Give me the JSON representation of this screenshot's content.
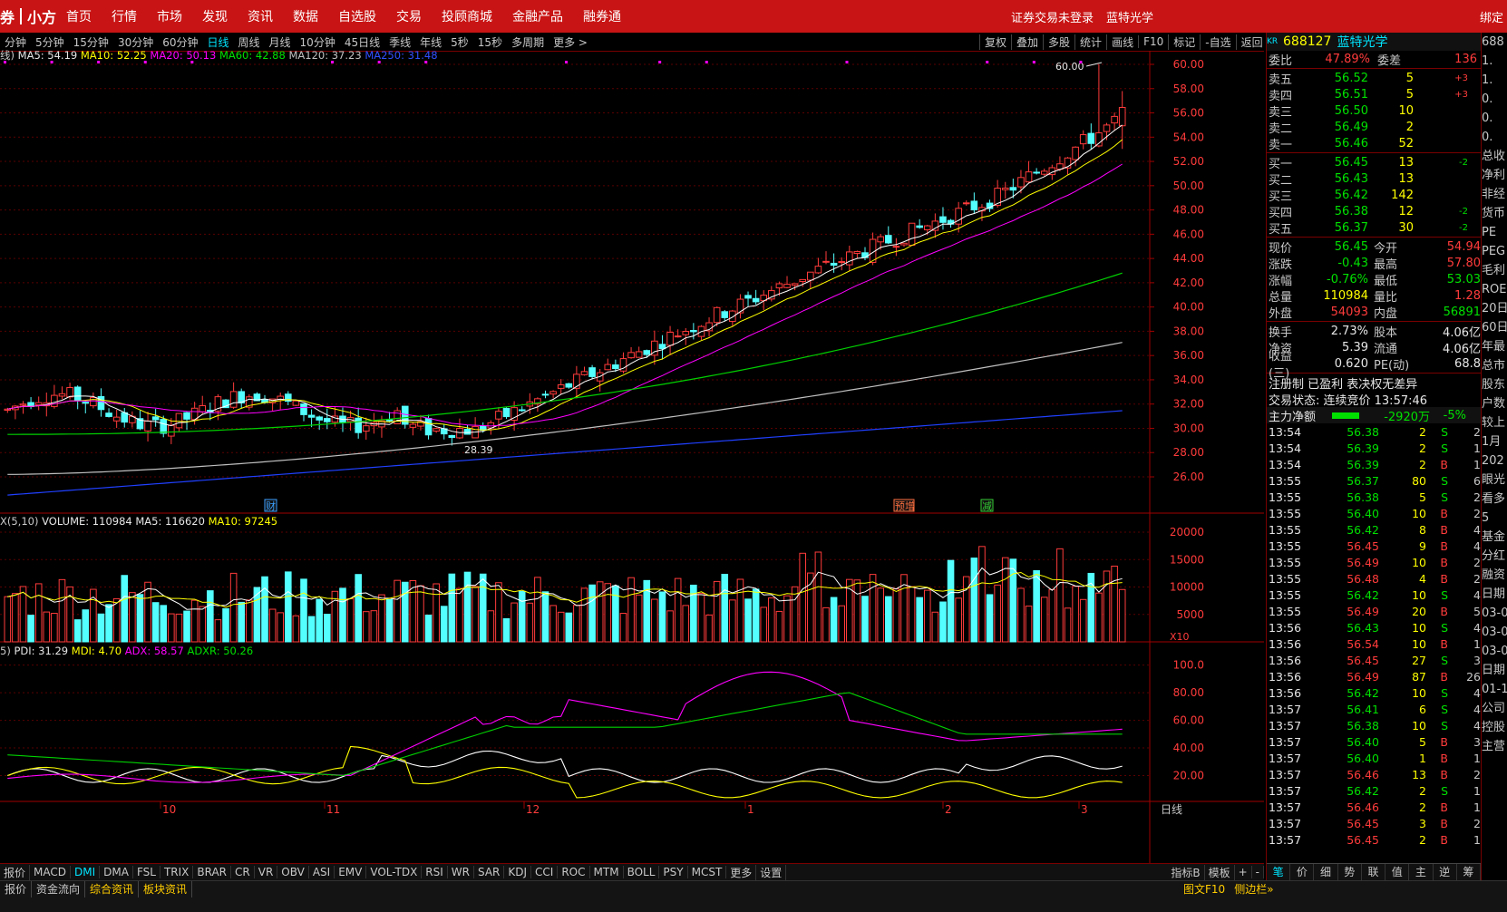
{
  "topbar": {
    "brand_left": "券",
    "brand_right": "小方",
    "nav": [
      "首页",
      "行情",
      "市场",
      "发现",
      "资讯",
      "数据",
      "自选股",
      "交易",
      "投顾商城",
      "金融产品",
      "融券通"
    ],
    "login_status": "证券交易未登录",
    "stock_name": "蓝特光学",
    "bind": "绑定"
  },
  "periods": [
    "分钟",
    "5分钟",
    "15分钟",
    "30分钟",
    "60分钟",
    "日线",
    "周线",
    "月线",
    "10分钟",
    "45日线",
    "季线",
    "年线",
    "5秒",
    "15秒",
    "多周期",
    "更多 >"
  ],
  "active_period": "日线",
  "tools": [
    "复权",
    "叠加",
    "多股",
    "统计",
    "画线",
    "F10",
    "标记",
    "-自选",
    "返回"
  ],
  "ma_legend": {
    "prefix": "线)",
    "ma5": "MA5: 54.19",
    "ma10": "MA10: 52.25",
    "ma20": "MA20: 50.13",
    "ma60": "MA60: 42.88",
    "ma120": "MA120: 37.23",
    "ma250": "MA250: 31.48"
  },
  "vol_legend": {
    "prefix": "X(5,10)",
    "volume": "VOLUME: 110984",
    "ma5": "MA5: 116620",
    "ma10": "MA10: 97245"
  },
  "dmi_legend": {
    "prefix": "5)",
    "pdi": "PDI: 31.29",
    "mdi": "MDI: 4.70",
    "adx": "ADX: 58.57",
    "adxr": "ADXR: 50.26"
  },
  "price_axis": [
    "60.00",
    "58.00",
    "56.00",
    "54.00",
    "52.00",
    "50.00",
    "48.00",
    "46.00",
    "44.00",
    "42.00",
    "40.00",
    "38.00",
    "36.00",
    "34.00",
    "32.00",
    "30.00",
    "28.00",
    "26.00"
  ],
  "vol_axis": [
    "20000",
    "15000",
    "10000",
    "5000"
  ],
  "vol_unit": "X10",
  "dmi_axis": [
    "100.0",
    "80.00",
    "60.00",
    "40.00",
    "20.00"
  ],
  "x_labels": [
    "10",
    "11",
    "12",
    "1",
    "2",
    "3"
  ],
  "x_axis_unit": "日线",
  "markers": {
    "high": "60.00",
    "low": "28.39",
    "cai": "财",
    "yu": "预增",
    "jian": "减"
  },
  "indicator_tabs": [
    "报价",
    "MACD",
    "DMI",
    "DMA",
    "FSL",
    "TRIX",
    "BRAR",
    "CR",
    "VR",
    "OBV",
    "ASI",
    "EMV",
    "VOL-TDX",
    "RSI",
    "WR",
    "SAR",
    "KDJ",
    "CCI",
    "ROC",
    "MTM",
    "BOLL",
    "PSY",
    "MCST",
    "更多",
    "设置"
  ],
  "active_indicator": "DMI",
  "indicator_right": [
    "指标B",
    "模板",
    "+",
    "-"
  ],
  "status_tabs": [
    "报价",
    "资金流向",
    "综合资讯",
    "板块资讯"
  ],
  "status_right": [
    "图文F10",
    "侧边栏»"
  ],
  "quote": {
    "code": "688127",
    "name": "蓝特光学",
    "weibi_label": "委比",
    "weibi": "47.89%",
    "weicha_label": "委差",
    "weicha": "136",
    "asks": [
      {
        "label": "卖五",
        "price": "56.52",
        "vol": "5",
        "chg": "+3"
      },
      {
        "label": "卖四",
        "price": "56.51",
        "vol": "5",
        "chg": "+3"
      },
      {
        "label": "卖三",
        "price": "56.50",
        "vol": "10",
        "chg": ""
      },
      {
        "label": "卖二",
        "price": "56.49",
        "vol": "2",
        "chg": ""
      },
      {
        "label": "卖一",
        "price": "56.46",
        "vol": "52",
        "chg": ""
      }
    ],
    "bids": [
      {
        "label": "买一",
        "price": "56.45",
        "vol": "13",
        "chg": "-2"
      },
      {
        "label": "买二",
        "price": "56.43",
        "vol": "13",
        "chg": ""
      },
      {
        "label": "买三",
        "price": "56.42",
        "vol": "142",
        "chg": ""
      },
      {
        "label": "买四",
        "price": "56.38",
        "vol": "12",
        "chg": "-2"
      },
      {
        "label": "买五",
        "price": "56.37",
        "vol": "30",
        "chg": "-2"
      }
    ],
    "stats": [
      {
        "l1": "现价",
        "v1": "56.45",
        "c1": "green",
        "l2": "今开",
        "v2": "54.94",
        "c2": "red"
      },
      {
        "l1": "涨跌",
        "v1": "-0.43",
        "c1": "green",
        "l2": "最高",
        "v2": "57.80",
        "c2": "red"
      },
      {
        "l1": "涨幅",
        "v1": "-0.76%",
        "c1": "green",
        "l2": "最低",
        "v2": "53.03",
        "c2": "green"
      },
      {
        "l1": "总量",
        "v1": "110984",
        "c1": "yellow",
        "l2": "量比",
        "v2": "1.28",
        "c2": "red"
      },
      {
        "l1": "外盘",
        "v1": "54093",
        "c1": "red",
        "l2": "内盘",
        "v2": "56891",
        "c2": "green"
      }
    ],
    "stats2": [
      {
        "l1": "换手",
        "v1": "2.73%",
        "l2": "股本",
        "v2": "4.06亿"
      },
      {
        "l1": "净资",
        "v1": "5.39",
        "l2": "流通",
        "v2": "4.06亿"
      },
      {
        "l1": "收益(三)",
        "v1": "0.620",
        "l2": "PE(动)",
        "v2": "68.8"
      }
    ],
    "reg": "注册制 已盈利 表决权无差异",
    "trade_status": "交易状态: 连续竞价 13:57:46",
    "main_net_label": "主力净额",
    "main_net": "-2920万",
    "main_net_pct": "-5%"
  },
  "ticks": [
    {
      "t": "13:54",
      "p": "56.38",
      "v": "2",
      "d": "S",
      "n": "2"
    },
    {
      "t": "13:54",
      "p": "56.39",
      "v": "2",
      "d": "S",
      "n": "1"
    },
    {
      "t": "13:54",
      "p": "56.39",
      "v": "2",
      "d": "B",
      "n": "1"
    },
    {
      "t": "13:55",
      "p": "56.37",
      "v": "80",
      "d": "S",
      "n": "6"
    },
    {
      "t": "13:55",
      "p": "56.38",
      "v": "5",
      "d": "S",
      "n": "2"
    },
    {
      "t": "13:55",
      "p": "56.40",
      "v": "10",
      "d": "B",
      "n": "2"
    },
    {
      "t": "13:55",
      "p": "56.42",
      "v": "8",
      "d": "B",
      "n": "4"
    },
    {
      "t": "13:55",
      "p": "56.45",
      "v": "9",
      "d": "B",
      "n": "4"
    },
    {
      "t": "13:55",
      "p": "56.49",
      "v": "10",
      "d": "B",
      "n": "2"
    },
    {
      "t": "13:55",
      "p": "56.48",
      "v": "4",
      "d": "B",
      "n": "2"
    },
    {
      "t": "13:55",
      "p": "56.42",
      "v": "10",
      "d": "S",
      "n": "4"
    },
    {
      "t": "13:55",
      "p": "56.49",
      "v": "20",
      "d": "B",
      "n": "5"
    },
    {
      "t": "13:56",
      "p": "56.43",
      "v": "10",
      "d": "S",
      "n": "4"
    },
    {
      "t": "13:56",
      "p": "56.54",
      "v": "10",
      "d": "B",
      "n": "1"
    },
    {
      "t": "13:56",
      "p": "56.45",
      "v": "27",
      "d": "S",
      "n": "3"
    },
    {
      "t": "13:56",
      "p": "56.49",
      "v": "87",
      "d": "B",
      "n": "26"
    },
    {
      "t": "13:56",
      "p": "56.42",
      "v": "10",
      "d": "S",
      "n": "4"
    },
    {
      "t": "13:57",
      "p": "56.41",
      "v": "6",
      "d": "S",
      "n": "4"
    },
    {
      "t": "13:57",
      "p": "56.38",
      "v": "10",
      "d": "S",
      "n": "4"
    },
    {
      "t": "13:57",
      "p": "56.40",
      "v": "5",
      "d": "B",
      "n": "3"
    },
    {
      "t": "13:57",
      "p": "56.40",
      "v": "1",
      "d": "B",
      "n": "1"
    },
    {
      "t": "13:57",
      "p": "56.46",
      "v": "13",
      "d": "B",
      "n": "2"
    },
    {
      "t": "13:57",
      "p": "56.42",
      "v": "2",
      "d": "S",
      "n": "1"
    },
    {
      "t": "13:57",
      "p": "56.46",
      "v": "2",
      "d": "B",
      "n": "1"
    },
    {
      "t": "13:57",
      "p": "56.45",
      "v": "3",
      "d": "B",
      "n": "2"
    },
    {
      "t": "13:57",
      "p": "56.45",
      "v": "2",
      "d": "B",
      "n": "1"
    }
  ],
  "bottom_tabs": [
    "笔",
    "价",
    "细",
    "势",
    "联",
    "值",
    "主",
    "逆",
    "筹"
  ],
  "far_right": [
    "688",
    "1.",
    "1.",
    "0.",
    "0.",
    "0.",
    "总收",
    "净利",
    "非经",
    "货币",
    "PE",
    "PEG",
    "毛利",
    "ROE",
    "20日",
    "60日",
    "年最",
    "总市",
    "股东",
    "户数",
    "较上",
    "1月",
    "202",
    "眼光",
    "看多",
    "5",
    "基金",
    "分红",
    "融资",
    "日期",
    "03-0",
    "03-0",
    "03-0",
    "日期",
    "01-1",
    "公司",
    "控股",
    "主营"
  ],
  "colors": {
    "up": "#ff3b3b",
    "down": "#54ffff",
    "ma5": "#ffffff",
    "ma10": "#ffff00",
    "ma20": "#ff00ff",
    "ma60": "#00d000",
    "ma120": "#c0c0c0",
    "ma250": "#2040ff"
  }
}
